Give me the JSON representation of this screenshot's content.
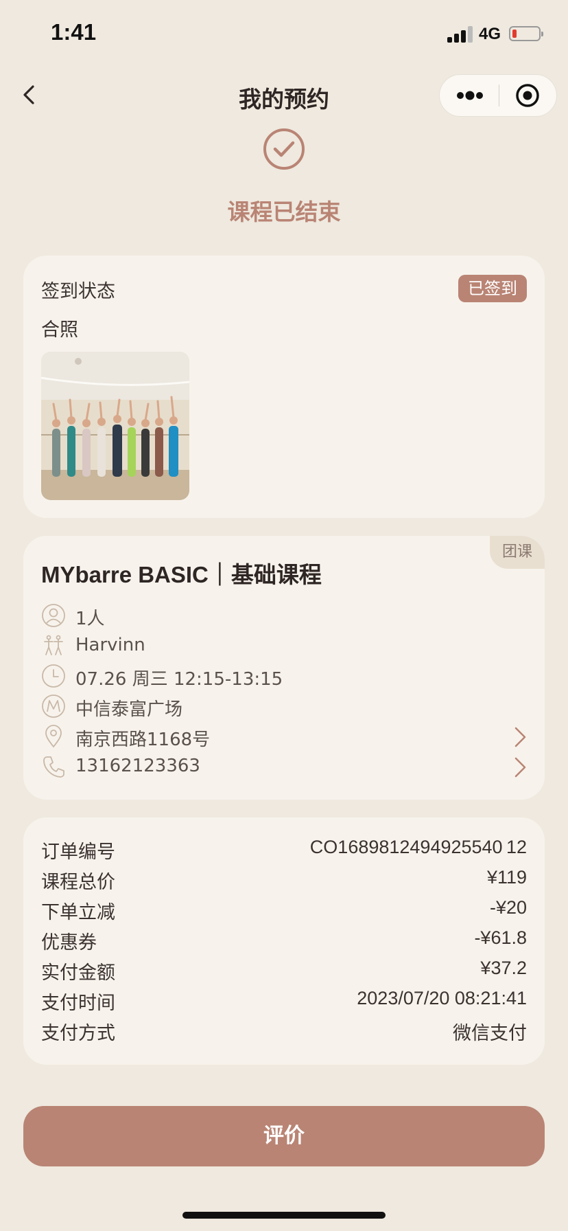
{
  "status_bar": {
    "time": "1:41",
    "network": "4G"
  },
  "nav": {
    "title": "我的预约"
  },
  "header": {
    "status": "课程已结束"
  },
  "checkin": {
    "status_label": "签到状态",
    "badge": "已签到",
    "photo_label": "合照"
  },
  "course": {
    "tag": "团课",
    "name": "MYbarre BASIC｜基础课程",
    "people": "1人",
    "coach": "Harvinn",
    "time": "07.26 周三 12:15-13:15",
    "venue": "中信泰富广场",
    "address": "南京西路1168号",
    "phone": "13162123363"
  },
  "order": {
    "rows": [
      {
        "label": "订单编号",
        "value": "CO1689812494925540 12"
      },
      {
        "label": "课程总价",
        "value": "¥119"
      },
      {
        "label": "下单立减",
        "value": "-¥20"
      },
      {
        "label": "优惠券",
        "value": "-¥61.8"
      },
      {
        "label": "实付金额",
        "value": "¥37.2"
      },
      {
        "label": "支付时间",
        "value": "2023/07/20 08:21:41"
      },
      {
        "label": "支付方式",
        "value": "微信支付"
      }
    ]
  },
  "actions": {
    "review": "评价"
  },
  "colors": {
    "accent": "#b98474",
    "background": "#efe9df",
    "card": "#f7f3ec"
  }
}
